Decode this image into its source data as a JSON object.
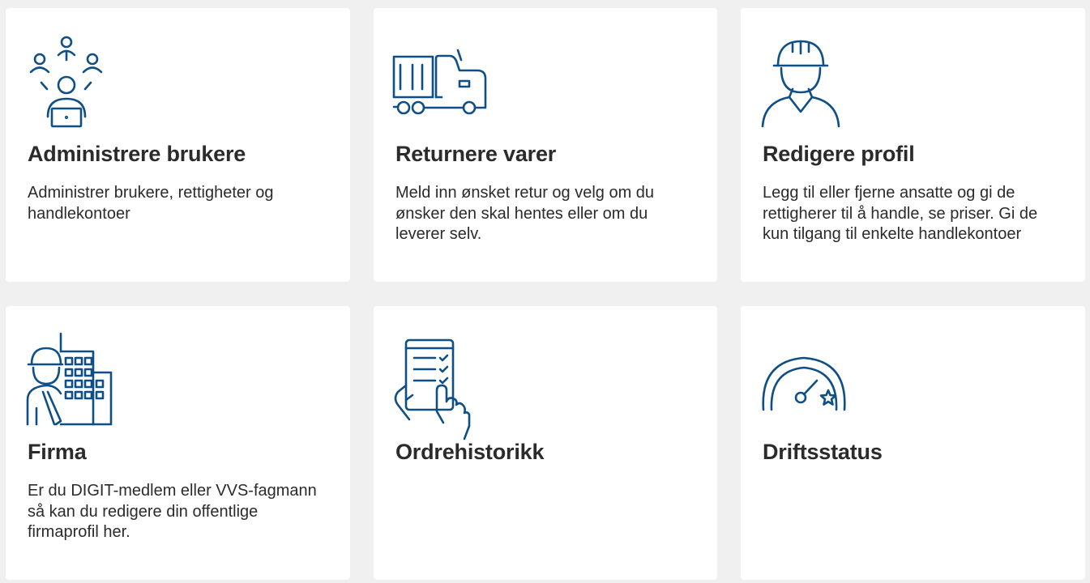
{
  "colors": {
    "background": "#f0f0f0",
    "card": "#ffffff",
    "icon": "#0f4f85",
    "text": "#2b2b2b"
  },
  "cards": [
    {
      "icon": "users-network-icon",
      "title": "Administrere brukere",
      "description": "Administrer brukere, rettigheter og handlekontoer"
    },
    {
      "icon": "truck-icon",
      "title": "Returnere varer",
      "description": "Meld inn ønsket retur og velg om du ønsker den skal hentes eller om du leverer selv."
    },
    {
      "icon": "worker-helmet-icon",
      "title": "Redigere profil",
      "description": "Legg til eller fjerne ansatte og gi de rettigherer til å handle, se priser. Gi de kun tilgang til enkelte handlekontoer"
    },
    {
      "icon": "worker-building-icon",
      "title": "Firma",
      "description": "Er du DIGIT-medlem eller VVS-fagmann så kan du redigere din offentlige firmaprofil her."
    },
    {
      "icon": "checklist-tablet-icon",
      "title": "Ordrehistorikk",
      "description": ""
    },
    {
      "icon": "gauge-star-icon",
      "title": "Driftsstatus",
      "description": ""
    }
  ]
}
